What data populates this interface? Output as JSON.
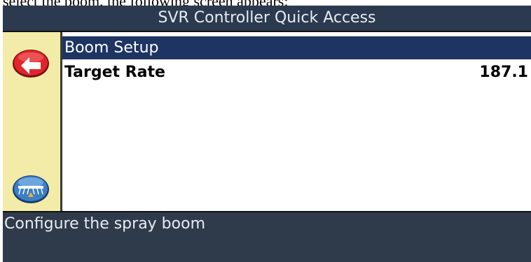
{
  "doc_caption": "select the boom, the following screen appears:",
  "window": {
    "title": "SVR Controller Quick Access"
  },
  "sidebar": {
    "back_button_icon": "back-arrow-icon",
    "sprayer_button_icon": "sprayer-boom-icon",
    "background_color": "#f2eca8"
  },
  "menu": {
    "items": [
      {
        "label": "Boom Setup",
        "value": "",
        "selected": true
      },
      {
        "label": "Target Rate",
        "value": "187.1",
        "selected": false
      }
    ],
    "selection_color": "#1e3563"
  },
  "status": {
    "help_text": "Configure the spray boom"
  }
}
